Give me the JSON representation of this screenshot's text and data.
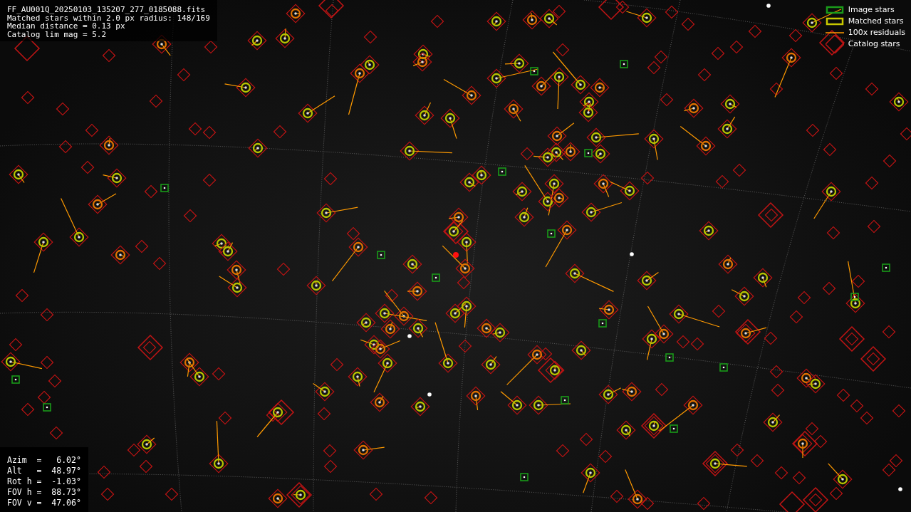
{
  "header": {
    "lines": [
      "FF_AU001Q_20250103_135207_277_0185088.fits",
      "Matched stars within 2.0 px radius: 148/169",
      "Median distance = 0.13 px",
      "Catalog lim mag = 5.2"
    ]
  },
  "legend": [
    {
      "kind": "image_star",
      "label": "Image stars"
    },
    {
      "kind": "matched_star",
      "label": "Matched stars"
    },
    {
      "kind": "residual",
      "label": "100x residuals"
    },
    {
      "kind": "catalog_star",
      "label": "Catalog stars"
    }
  ],
  "camera_info": {
    "lines": [
      "Azim  =   6.02°",
      "Alt   =  48.97°",
      "Rot h =  -1.03°",
      "FOV h =  88.73°",
      "FOV v =  47.06°"
    ]
  }
}
